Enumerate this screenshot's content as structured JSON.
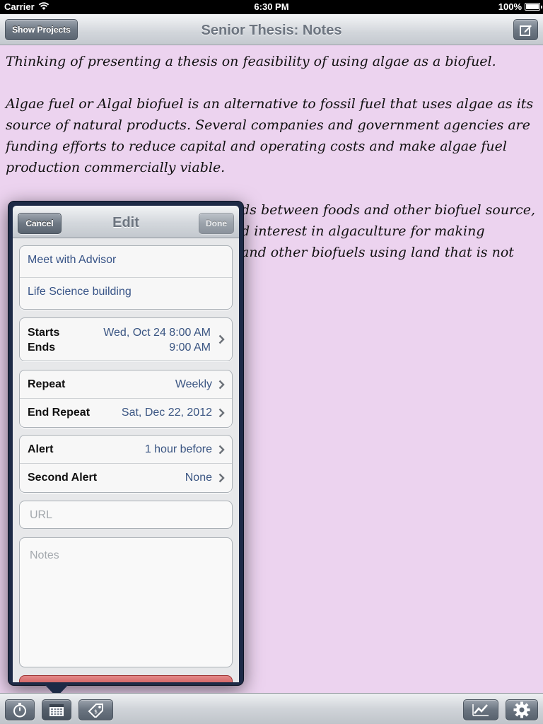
{
  "status_bar": {
    "carrier": "Carrier",
    "time": "6:30 PM",
    "battery": "100%"
  },
  "navbar": {
    "title": "Senior Thesis: Notes",
    "left_button": "Show Projects"
  },
  "note": {
    "paragraphs": [
      "Thinking of presenting a thesis on feasibility of using algae as a biofuel.",
      "Algae fuel or Algal biofuel is an alternative to fossil fuel that uses algae as its source of natural products. Several companies and government agencies are funding efforts to reduce capital and operating costs and make algae fuel production commercially viable.",
      "ds between foods and other biofuel source,",
      "d interest in algaculture for making",
      "and other biofuels using land that is not"
    ]
  },
  "popover": {
    "title": "Edit",
    "cancel": "Cancel",
    "done": "Done",
    "event_title": "Meet with Advisor",
    "location": "Life Science building",
    "starts_label": "Starts",
    "ends_label": "Ends",
    "starts_value": "Wed, Oct 24  8:00 AM",
    "ends_value": "9:00 AM",
    "repeat_label": "Repeat",
    "repeat_value": "Weekly",
    "end_repeat_label": "End Repeat",
    "end_repeat_value": "Sat, Dec 22, 2012",
    "alert_label": "Alert",
    "alert_value": "1 hour before",
    "second_alert_label": "Second Alert",
    "second_alert_value": "None",
    "url_placeholder": "URL",
    "notes_placeholder": "Notes"
  },
  "toolbar": {
    "icons": [
      "stopwatch-icon",
      "calendar-icon",
      "price-tag-icon",
      "chart-icon",
      "gear-icon"
    ]
  },
  "colors": {
    "note_background": "#ecd3ef",
    "value_text": "#3a5582",
    "popover_frame": "#1d2a46"
  }
}
